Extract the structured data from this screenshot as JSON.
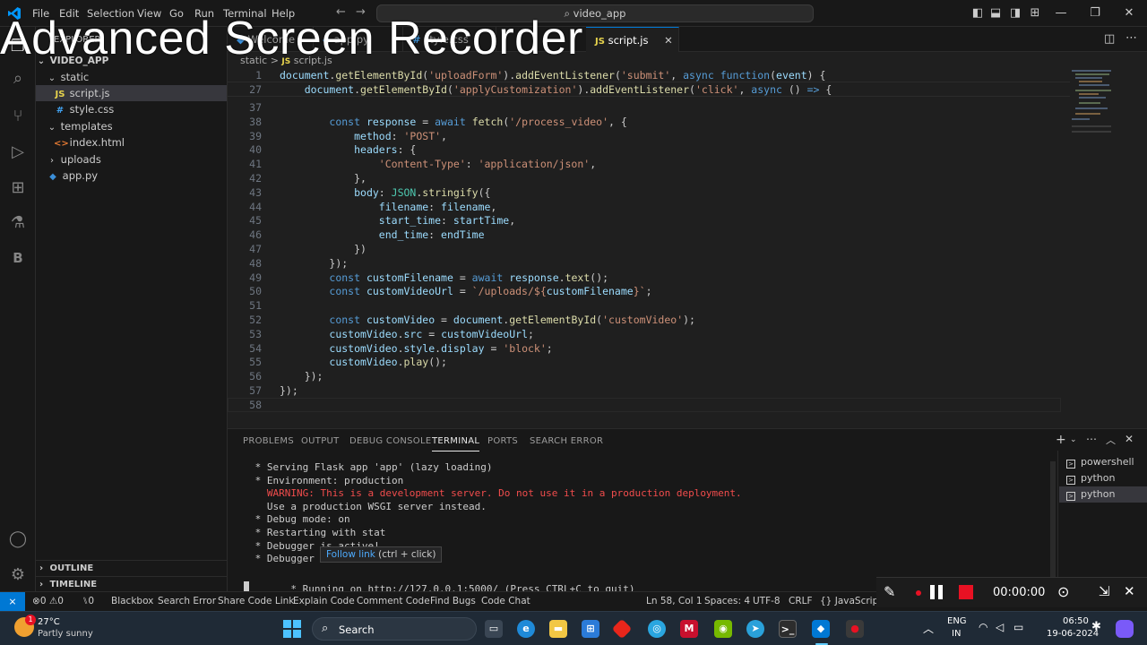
{
  "watermark": "Advanced Screen Recorder",
  "window": {
    "menu": [
      "File",
      "Edit",
      "Selection",
      "View",
      "Go",
      "Run",
      "Terminal",
      "Help"
    ],
    "search": "video_app"
  },
  "sidebar": {
    "header": "EXPLORER",
    "project": "VIDEO_APP",
    "items": [
      {
        "label": "static",
        "type": "folder"
      },
      {
        "label": "script.js",
        "type": "js"
      },
      {
        "label": "style.css",
        "type": "css"
      },
      {
        "label": "templates",
        "type": "folder"
      },
      {
        "label": "index.html",
        "type": "html"
      },
      {
        "label": "uploads",
        "type": "folder"
      },
      {
        "label": "app.py",
        "type": "py"
      }
    ],
    "outline": "OUTLINE",
    "timeline": "TIMELINE"
  },
  "tabs": [
    {
      "label": "Welcome"
    },
    {
      "label": "app.py"
    },
    {
      "label": "style.css"
    },
    {
      "label": "script.js",
      "active": true
    }
  ],
  "breadcrumb": {
    "folder": "static",
    "sep": ">",
    "file": "script.js"
  },
  "editor": {
    "sticky": [
      {
        "n": "1",
        "indent": "",
        "parts": [
          [
            "var",
            "document"
          ],
          [
            "pun",
            "."
          ],
          [
            "fn",
            "getElementById"
          ],
          [
            "pun",
            "("
          ],
          [
            "str",
            "'uploadForm'"
          ],
          [
            "pun",
            ")."
          ],
          [
            "fn",
            "addEventListener"
          ],
          [
            "pun",
            "("
          ],
          [
            "str",
            "'submit'"
          ],
          [
            "pun",
            ", "
          ],
          [
            "kw",
            "async"
          ],
          [
            "pun",
            " "
          ],
          [
            "kw",
            "function"
          ],
          [
            "pun",
            "("
          ],
          [
            "var",
            "event"
          ],
          [
            "pun",
            ") {"
          ]
        ]
      },
      {
        "n": "27",
        "indent": "    ",
        "parts": [
          [
            "var",
            "document"
          ],
          [
            "pun",
            "."
          ],
          [
            "fn",
            "getElementById"
          ],
          [
            "pun",
            "("
          ],
          [
            "str",
            "'applyCustomization'"
          ],
          [
            "pun",
            ")."
          ],
          [
            "fn",
            "addEventListener"
          ],
          [
            "pun",
            "("
          ],
          [
            "str",
            "'click'"
          ],
          [
            "pun",
            ", "
          ],
          [
            "kw",
            "async"
          ],
          [
            "pun",
            " () "
          ],
          [
            "kw",
            "=>"
          ],
          [
            "pun",
            " {"
          ]
        ]
      }
    ],
    "lines": [
      {
        "n": "37",
        "indent": "",
        "parts": []
      },
      {
        "n": "38",
        "indent": "        ",
        "parts": [
          [
            "kw",
            "const"
          ],
          [
            "pun",
            " "
          ],
          [
            "var",
            "response"
          ],
          [
            "pun",
            " = "
          ],
          [
            "kw",
            "await"
          ],
          [
            "pun",
            " "
          ],
          [
            "fn",
            "fetch"
          ],
          [
            "pun",
            "("
          ],
          [
            "str",
            "'/process_video'"
          ],
          [
            "pun",
            ", {"
          ]
        ]
      },
      {
        "n": "39",
        "indent": "            ",
        "parts": [
          [
            "var",
            "method"
          ],
          [
            "pun",
            ": "
          ],
          [
            "str",
            "'POST'"
          ],
          [
            "pun",
            ","
          ]
        ]
      },
      {
        "n": "40",
        "indent": "            ",
        "parts": [
          [
            "var",
            "headers"
          ],
          [
            "pun",
            ": {"
          ]
        ]
      },
      {
        "n": "41",
        "indent": "                ",
        "parts": [
          [
            "str",
            "'Content-Type'"
          ],
          [
            "pun",
            ": "
          ],
          [
            "str",
            "'application/json'"
          ],
          [
            "pun",
            ","
          ]
        ]
      },
      {
        "n": "42",
        "indent": "            ",
        "parts": [
          [
            "pun",
            "},"
          ]
        ]
      },
      {
        "n": "43",
        "indent": "            ",
        "parts": [
          [
            "var",
            "body"
          ],
          [
            "pun",
            ": "
          ],
          [
            "cls",
            "JSON"
          ],
          [
            "pun",
            "."
          ],
          [
            "fn",
            "stringify"
          ],
          [
            "pun",
            "({"
          ]
        ]
      },
      {
        "n": "44",
        "indent": "                ",
        "parts": [
          [
            "var",
            "filename"
          ],
          [
            "pun",
            ": "
          ],
          [
            "var",
            "filename"
          ],
          [
            "pun",
            ","
          ]
        ]
      },
      {
        "n": "45",
        "indent": "                ",
        "parts": [
          [
            "var",
            "start_time"
          ],
          [
            "pun",
            ": "
          ],
          [
            "var",
            "startTime"
          ],
          [
            "pun",
            ","
          ]
        ]
      },
      {
        "n": "46",
        "indent": "                ",
        "parts": [
          [
            "var",
            "end_time"
          ],
          [
            "pun",
            ": "
          ],
          [
            "var",
            "endTime"
          ]
        ]
      },
      {
        "n": "47",
        "indent": "            ",
        "parts": [
          [
            "pun",
            "})"
          ]
        ]
      },
      {
        "n": "48",
        "indent": "        ",
        "parts": [
          [
            "pun",
            "});"
          ]
        ]
      },
      {
        "n": "49",
        "indent": "        ",
        "parts": [
          [
            "kw",
            "const"
          ],
          [
            "pun",
            " "
          ],
          [
            "var",
            "customFilename"
          ],
          [
            "pun",
            " = "
          ],
          [
            "kw",
            "await"
          ],
          [
            "pun",
            " "
          ],
          [
            "var",
            "response"
          ],
          [
            "pun",
            "."
          ],
          [
            "fn",
            "text"
          ],
          [
            "pun",
            "();"
          ]
        ]
      },
      {
        "n": "50",
        "indent": "        ",
        "parts": [
          [
            "kw",
            "const"
          ],
          [
            "pun",
            " "
          ],
          [
            "var",
            "customVideoUrl"
          ],
          [
            "pun",
            " = "
          ],
          [
            "str",
            "`/uploads/${"
          ],
          [
            "var",
            "customFilename"
          ],
          [
            "str",
            "}`"
          ],
          [
            "pun",
            ";"
          ]
        ]
      },
      {
        "n": "51",
        "indent": "",
        "parts": []
      },
      {
        "n": "52",
        "indent": "        ",
        "parts": [
          [
            "kw",
            "const"
          ],
          [
            "pun",
            " "
          ],
          [
            "var",
            "customVideo"
          ],
          [
            "pun",
            " = "
          ],
          [
            "var",
            "document"
          ],
          [
            "pun",
            "."
          ],
          [
            "fn",
            "getElementById"
          ],
          [
            "pun",
            "("
          ],
          [
            "str",
            "'customVideo'"
          ],
          [
            "pun",
            ");"
          ]
        ]
      },
      {
        "n": "53",
        "indent": "        ",
        "parts": [
          [
            "var",
            "customVideo"
          ],
          [
            "pun",
            "."
          ],
          [
            "var",
            "src"
          ],
          [
            "pun",
            " = "
          ],
          [
            "var",
            "customVideoUrl"
          ],
          [
            "pun",
            ";"
          ]
        ]
      },
      {
        "n": "54",
        "indent": "        ",
        "parts": [
          [
            "var",
            "customVideo"
          ],
          [
            "pun",
            "."
          ],
          [
            "var",
            "style"
          ],
          [
            "pun",
            "."
          ],
          [
            "var",
            "display"
          ],
          [
            "pun",
            " = "
          ],
          [
            "str",
            "'block'"
          ],
          [
            "pun",
            ";"
          ]
        ]
      },
      {
        "n": "55",
        "indent": "        ",
        "parts": [
          [
            "var",
            "customVideo"
          ],
          [
            "pun",
            "."
          ],
          [
            "fn",
            "play"
          ],
          [
            "pun",
            "();"
          ]
        ]
      },
      {
        "n": "56",
        "indent": "    ",
        "parts": [
          [
            "pun",
            "});"
          ]
        ]
      },
      {
        "n": "57",
        "indent": "",
        "parts": [
          [
            "pun",
            "});"
          ]
        ]
      },
      {
        "n": "58",
        "indent": "",
        "parts": []
      }
    ]
  },
  "panel": {
    "tabs": [
      "PROBLEMS",
      "OUTPUT",
      "DEBUG CONSOLE",
      "TERMINAL",
      "PORTS",
      "SEARCH ERROR"
    ],
    "active_tab": "TERMINAL",
    "terminal_lines": [
      {
        "text": " * Serving Flask app 'app' (lazy loading)",
        "warn": false
      },
      {
        "text": " * Environment: production",
        "warn": false
      },
      {
        "text": "   WARNING: This is a development server. Do not use it in a production deployment.",
        "warn": true
      },
      {
        "text": "   Use a production WSGI server instead.",
        "warn": false
      },
      {
        "text": " * Debug mode: on",
        "warn": false
      },
      {
        "text": " * Restarting with stat",
        "warn": false
      },
      {
        "text": " * Debugger is active!",
        "warn": false
      },
      {
        "text": " * Debugger PIN: ",
        "warn": false
      }
    ],
    "running_prefix": " * Running on ",
    "running_url": "http://127.0.0.1:5000/",
    "running_suffix": " (Press CTRL+C to quit)",
    "terminals": [
      "powershell",
      "python",
      "python"
    ],
    "tooltip_link": "Follow link",
    "tooltip_hint": " (ctrl + click)"
  },
  "status": {
    "errors": "0",
    "warnings": "0",
    "ports": "0",
    "items": [
      "Blackbox",
      "Search Error",
      "Share Code Link",
      "Explain Code",
      "Comment Code",
      "Find Bugs",
      "Code Chat"
    ],
    "position": "Ln 58, Col 1",
    "spaces": "Spaces: 4",
    "encoding": "UTF-8",
    "eol": "CRLF",
    "language": "JavaScript"
  },
  "recorder": {
    "timer": "00:00:00"
  },
  "taskbar": {
    "weather_temp": "27°C",
    "weather_desc": "Partly sunny",
    "search": "Search",
    "lang1": "ENG",
    "lang2": "IN",
    "time": "06:50",
    "date": "19-06-2024",
    "badge": "1"
  },
  "colors": {
    "accent": "#0078d4",
    "warning": "#f14c4c",
    "record": "#e81123"
  }
}
